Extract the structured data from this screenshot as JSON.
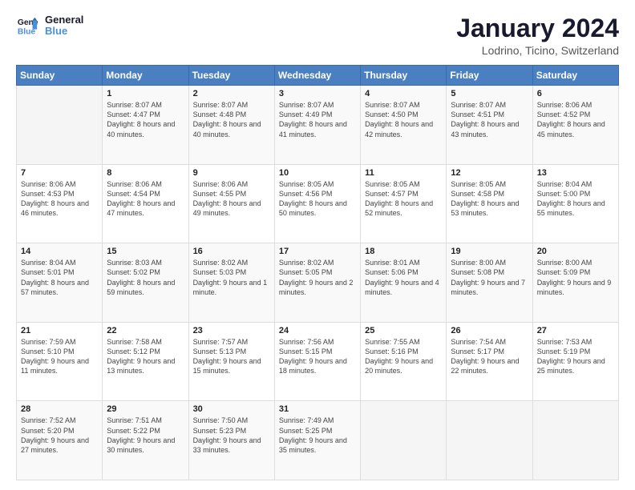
{
  "header": {
    "logo_line1": "General",
    "logo_line2": "Blue",
    "title": "January 2024",
    "subtitle": "Lodrino, Ticino, Switzerland"
  },
  "weekdays": [
    "Sunday",
    "Monday",
    "Tuesday",
    "Wednesday",
    "Thursday",
    "Friday",
    "Saturday"
  ],
  "weeks": [
    [
      {
        "day": "",
        "sunrise": "",
        "sunset": "",
        "daylight": ""
      },
      {
        "day": "1",
        "sunrise": "Sunrise: 8:07 AM",
        "sunset": "Sunset: 4:47 PM",
        "daylight": "Daylight: 8 hours and 40 minutes."
      },
      {
        "day": "2",
        "sunrise": "Sunrise: 8:07 AM",
        "sunset": "Sunset: 4:48 PM",
        "daylight": "Daylight: 8 hours and 40 minutes."
      },
      {
        "day": "3",
        "sunrise": "Sunrise: 8:07 AM",
        "sunset": "Sunset: 4:49 PM",
        "daylight": "Daylight: 8 hours and 41 minutes."
      },
      {
        "day": "4",
        "sunrise": "Sunrise: 8:07 AM",
        "sunset": "Sunset: 4:50 PM",
        "daylight": "Daylight: 8 hours and 42 minutes."
      },
      {
        "day": "5",
        "sunrise": "Sunrise: 8:07 AM",
        "sunset": "Sunset: 4:51 PM",
        "daylight": "Daylight: 8 hours and 43 minutes."
      },
      {
        "day": "6",
        "sunrise": "Sunrise: 8:06 AM",
        "sunset": "Sunset: 4:52 PM",
        "daylight": "Daylight: 8 hours and 45 minutes."
      }
    ],
    [
      {
        "day": "7",
        "sunrise": "Sunrise: 8:06 AM",
        "sunset": "Sunset: 4:53 PM",
        "daylight": "Daylight: 8 hours and 46 minutes."
      },
      {
        "day": "8",
        "sunrise": "Sunrise: 8:06 AM",
        "sunset": "Sunset: 4:54 PM",
        "daylight": "Daylight: 8 hours and 47 minutes."
      },
      {
        "day": "9",
        "sunrise": "Sunrise: 8:06 AM",
        "sunset": "Sunset: 4:55 PM",
        "daylight": "Daylight: 8 hours and 49 minutes."
      },
      {
        "day": "10",
        "sunrise": "Sunrise: 8:05 AM",
        "sunset": "Sunset: 4:56 PM",
        "daylight": "Daylight: 8 hours and 50 minutes."
      },
      {
        "day": "11",
        "sunrise": "Sunrise: 8:05 AM",
        "sunset": "Sunset: 4:57 PM",
        "daylight": "Daylight: 8 hours and 52 minutes."
      },
      {
        "day": "12",
        "sunrise": "Sunrise: 8:05 AM",
        "sunset": "Sunset: 4:58 PM",
        "daylight": "Daylight: 8 hours and 53 minutes."
      },
      {
        "day": "13",
        "sunrise": "Sunrise: 8:04 AM",
        "sunset": "Sunset: 5:00 PM",
        "daylight": "Daylight: 8 hours and 55 minutes."
      }
    ],
    [
      {
        "day": "14",
        "sunrise": "Sunrise: 8:04 AM",
        "sunset": "Sunset: 5:01 PM",
        "daylight": "Daylight: 8 hours and 57 minutes."
      },
      {
        "day": "15",
        "sunrise": "Sunrise: 8:03 AM",
        "sunset": "Sunset: 5:02 PM",
        "daylight": "Daylight: 8 hours and 59 minutes."
      },
      {
        "day": "16",
        "sunrise": "Sunrise: 8:02 AM",
        "sunset": "Sunset: 5:03 PM",
        "daylight": "Daylight: 9 hours and 1 minute."
      },
      {
        "day": "17",
        "sunrise": "Sunrise: 8:02 AM",
        "sunset": "Sunset: 5:05 PM",
        "daylight": "Daylight: 9 hours and 2 minutes."
      },
      {
        "day": "18",
        "sunrise": "Sunrise: 8:01 AM",
        "sunset": "Sunset: 5:06 PM",
        "daylight": "Daylight: 9 hours and 4 minutes."
      },
      {
        "day": "19",
        "sunrise": "Sunrise: 8:00 AM",
        "sunset": "Sunset: 5:08 PM",
        "daylight": "Daylight: 9 hours and 7 minutes."
      },
      {
        "day": "20",
        "sunrise": "Sunrise: 8:00 AM",
        "sunset": "Sunset: 5:09 PM",
        "daylight": "Daylight: 9 hours and 9 minutes."
      }
    ],
    [
      {
        "day": "21",
        "sunrise": "Sunrise: 7:59 AM",
        "sunset": "Sunset: 5:10 PM",
        "daylight": "Daylight: 9 hours and 11 minutes."
      },
      {
        "day": "22",
        "sunrise": "Sunrise: 7:58 AM",
        "sunset": "Sunset: 5:12 PM",
        "daylight": "Daylight: 9 hours and 13 minutes."
      },
      {
        "day": "23",
        "sunrise": "Sunrise: 7:57 AM",
        "sunset": "Sunset: 5:13 PM",
        "daylight": "Daylight: 9 hours and 15 minutes."
      },
      {
        "day": "24",
        "sunrise": "Sunrise: 7:56 AM",
        "sunset": "Sunset: 5:15 PM",
        "daylight": "Daylight: 9 hours and 18 minutes."
      },
      {
        "day": "25",
        "sunrise": "Sunrise: 7:55 AM",
        "sunset": "Sunset: 5:16 PM",
        "daylight": "Daylight: 9 hours and 20 minutes."
      },
      {
        "day": "26",
        "sunrise": "Sunrise: 7:54 AM",
        "sunset": "Sunset: 5:17 PM",
        "daylight": "Daylight: 9 hours and 22 minutes."
      },
      {
        "day": "27",
        "sunrise": "Sunrise: 7:53 AM",
        "sunset": "Sunset: 5:19 PM",
        "daylight": "Daylight: 9 hours and 25 minutes."
      }
    ],
    [
      {
        "day": "28",
        "sunrise": "Sunrise: 7:52 AM",
        "sunset": "Sunset: 5:20 PM",
        "daylight": "Daylight: 9 hours and 27 minutes."
      },
      {
        "day": "29",
        "sunrise": "Sunrise: 7:51 AM",
        "sunset": "Sunset: 5:22 PM",
        "daylight": "Daylight: 9 hours and 30 minutes."
      },
      {
        "day": "30",
        "sunrise": "Sunrise: 7:50 AM",
        "sunset": "Sunset: 5:23 PM",
        "daylight": "Daylight: 9 hours and 33 minutes."
      },
      {
        "day": "31",
        "sunrise": "Sunrise: 7:49 AM",
        "sunset": "Sunset: 5:25 PM",
        "daylight": "Daylight: 9 hours and 35 minutes."
      },
      {
        "day": "",
        "sunrise": "",
        "sunset": "",
        "daylight": ""
      },
      {
        "day": "",
        "sunrise": "",
        "sunset": "",
        "daylight": ""
      },
      {
        "day": "",
        "sunrise": "",
        "sunset": "",
        "daylight": ""
      }
    ]
  ]
}
